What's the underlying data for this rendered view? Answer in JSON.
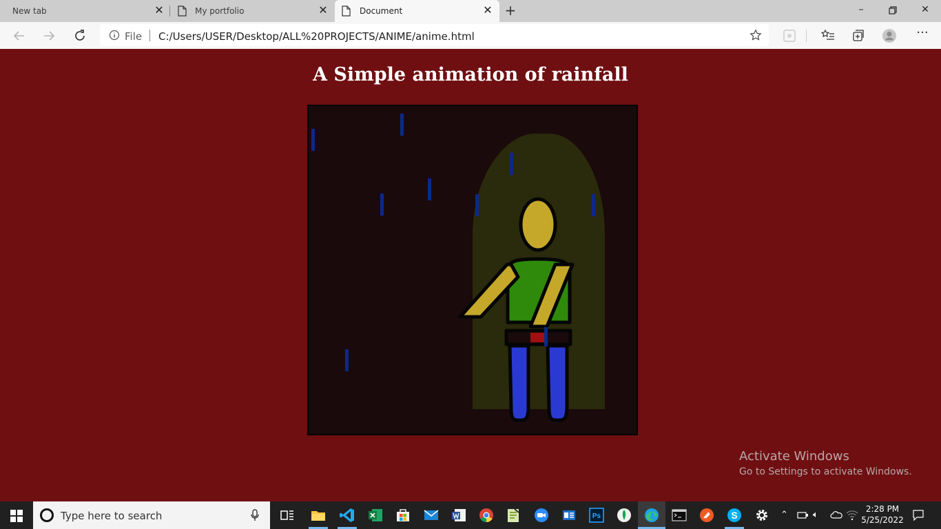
{
  "browser": {
    "tabs": [
      {
        "title": "New tab",
        "active": false
      },
      {
        "title": "My portfolio",
        "active": false
      },
      {
        "title": "Document",
        "active": true
      }
    ],
    "address": {
      "scheme_label": "File",
      "url": "C:/Users/USER/Desktop/ALL%20PROJECTS/ANIME/anime.html"
    }
  },
  "page": {
    "title": "A Simple animation of rainfall",
    "colors": {
      "page_background": "#6f0f12",
      "scene_background": "#1a0a0b",
      "shelter": "#2a2a0c",
      "skin": "#c5a82a",
      "shirt": "#2f8a0c",
      "belt_buckle": "#a01010",
      "trousers": "#2b39d3",
      "raindrop": "#0a2a86"
    }
  },
  "watermark": {
    "line1": "Activate Windows",
    "line2": "Go to Settings to activate Windows."
  },
  "taskbar": {
    "search_placeholder": "Type here to search",
    "apps": [
      "task-view",
      "file-explorer",
      "vs-code",
      "excel",
      "store",
      "mail",
      "word",
      "chrome",
      "notepad-plus",
      "zoom",
      "outlook",
      "photoshop",
      "mongodb-compass",
      "edge",
      "terminal",
      "brave",
      "skype",
      "settings"
    ],
    "time": "2:28 PM",
    "date": "5/25/2022"
  }
}
